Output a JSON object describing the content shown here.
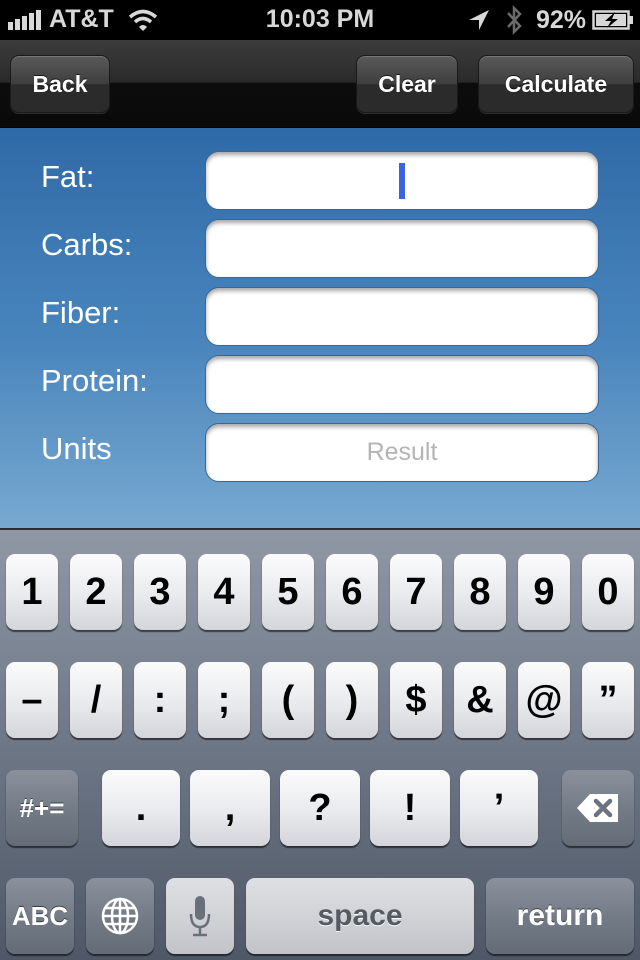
{
  "status_bar": {
    "carrier": "AT&T",
    "time": "10:03 PM",
    "battery_percent": "92%",
    "signal_bars": 5,
    "icons": [
      "signal-icon",
      "wifi-icon",
      "location-arrow-icon",
      "bluetooth-icon",
      "battery-charging-icon"
    ]
  },
  "nav_bar": {
    "back_label": "Back",
    "clear_label": "Clear",
    "calculate_label": "Calculate"
  },
  "form": {
    "rows": [
      {
        "label": "Fat:",
        "value": "",
        "placeholder": ""
      },
      {
        "label": "Carbs:",
        "value": "",
        "placeholder": ""
      },
      {
        "label": "Fiber:",
        "value": "",
        "placeholder": ""
      },
      {
        "label": "Protein:",
        "value": "",
        "placeholder": ""
      },
      {
        "label": "Units",
        "value": "",
        "placeholder": "Result"
      }
    ],
    "focused_field": "Fat:"
  },
  "keyboard": {
    "row1": [
      "1",
      "2",
      "3",
      "4",
      "5",
      "6",
      "7",
      "8",
      "9",
      "0"
    ],
    "row2": [
      "–",
      "/",
      ":",
      ";",
      "(",
      ")",
      "$",
      "&",
      "@",
      "”"
    ],
    "row3": [
      ".",
      ",",
      "?",
      "!",
      "’"
    ],
    "shift_label": "#+=",
    "abc_label": "ABC",
    "space_label": "space",
    "return_label": "return",
    "icons": [
      "backspace-icon",
      "globe-icon",
      "microphone-icon"
    ]
  },
  "colors": {
    "form_top": "#2f6aa8",
    "form_bottom": "#78a9d0",
    "cursor": "#3a63e0"
  }
}
